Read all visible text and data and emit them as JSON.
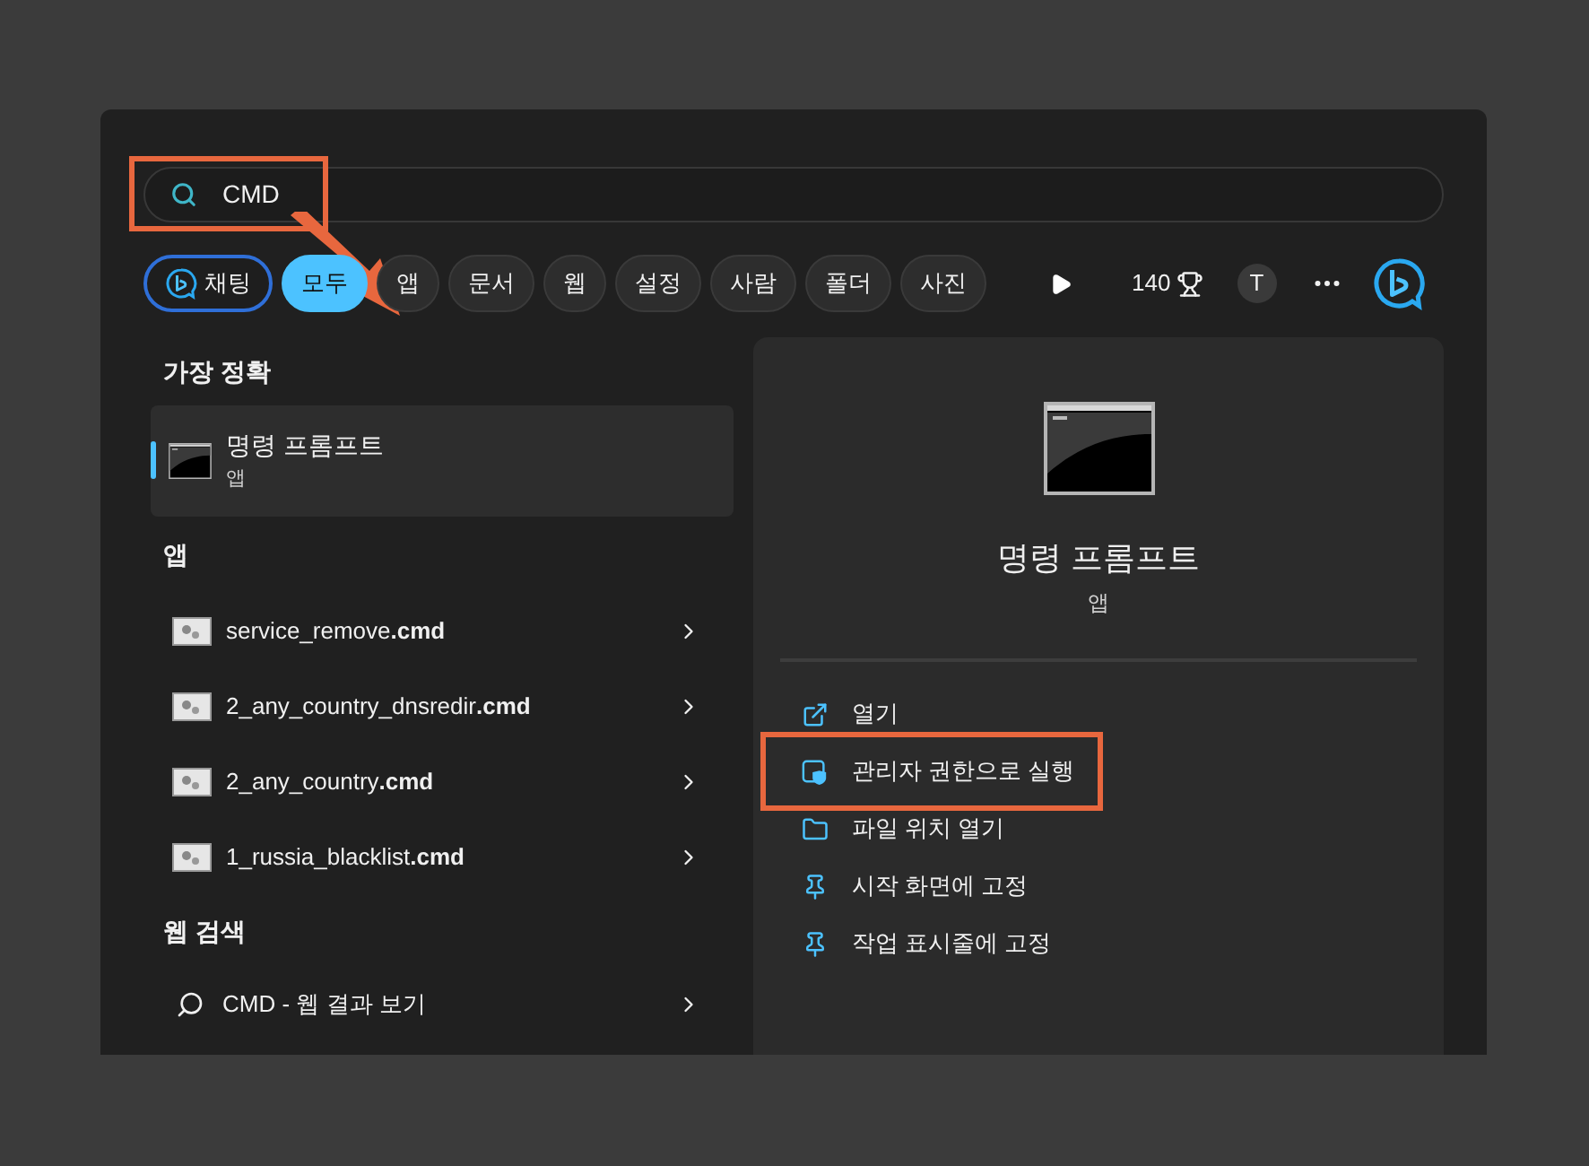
{
  "search": {
    "value": "CMD",
    "highlighted": true
  },
  "filters": [
    {
      "label": "채팅",
      "kind": "chat",
      "selected": false
    },
    {
      "label": "모두",
      "kind": "plain",
      "selected": true
    },
    {
      "label": "앱",
      "kind": "plain",
      "selected": false
    },
    {
      "label": "문서",
      "kind": "plain",
      "selected": false
    },
    {
      "label": "웹",
      "kind": "plain",
      "selected": false
    },
    {
      "label": "설정",
      "kind": "plain",
      "selected": false
    },
    {
      "label": "사람",
      "kind": "plain",
      "selected": false
    },
    {
      "label": "폴더",
      "kind": "plain",
      "selected": false
    },
    {
      "label": "사진",
      "kind": "plain",
      "selected": false
    }
  ],
  "toolbar": {
    "points": "140",
    "avatar": "T"
  },
  "best_match": {
    "heading": "가장 정확",
    "title": "명령 프롬프트",
    "subtitle": "앱",
    "selected": true
  },
  "apps": {
    "heading": "앱",
    "items": [
      {
        "name": "service_remove**.cmd**"
      },
      {
        "name": "2_any_country_dnsredir**.cmd**"
      },
      {
        "name": "2_any_country**.cmd**"
      },
      {
        "name": "1_russia_blacklist**.cmd**"
      }
    ]
  },
  "web_search": {
    "heading": "웹 검색",
    "items": [
      {
        "text": "CMD - 웹 결과 보기"
      }
    ]
  },
  "preview": {
    "title": "명령 프롬프트",
    "subtitle": "앱",
    "actions": [
      {
        "label": "열기",
        "kind": "open",
        "highlighted": false
      },
      {
        "label": "관리자 권한으로 실행",
        "kind": "admin",
        "highlighted": true
      },
      {
        "label": "파일 위치 열기",
        "kind": "folder",
        "highlighted": false
      },
      {
        "label": "시작 화면에 고정",
        "kind": "pin",
        "highlighted": false
      },
      {
        "label": "작업 표시줄에 고정",
        "kind": "pin",
        "highlighted": false
      }
    ]
  }
}
